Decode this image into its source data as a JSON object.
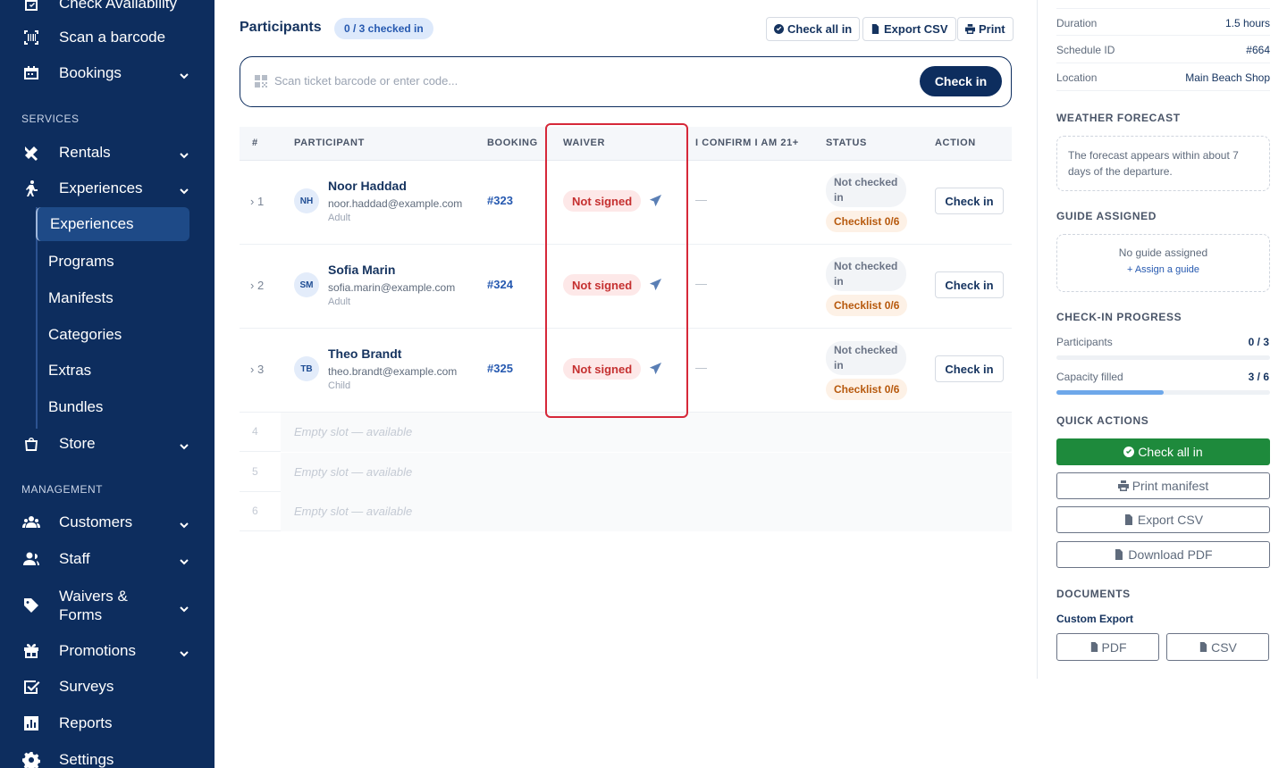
{
  "sidebar": {
    "top_items": [
      {
        "label": "Check Availability",
        "icon": "calendar-check-icon"
      },
      {
        "label": "Scan a barcode",
        "icon": "barcode-scan-icon"
      },
      {
        "label": "Bookings",
        "icon": "bookings-icon"
      }
    ],
    "services_heading": "SERVICES",
    "rentals": "Rentals",
    "experiences": "Experiences",
    "sub_items": [
      "Experiences",
      "Programs",
      "Manifests",
      "Categories",
      "Extras",
      "Bundles"
    ],
    "store": "Store",
    "management_heading": "MANAGEMENT",
    "customers": "Customers",
    "staff": "Staff",
    "waivers": "Waivers & Forms",
    "promotions": "Promotions",
    "surveys": "Surveys",
    "reports": "Reports",
    "settings": "Settings"
  },
  "participants": {
    "title": "Participants",
    "badge": "0 / 3 checked in",
    "check_all": "Check all in",
    "export_csv": "Export CSV",
    "print": "Print",
    "scan_placeholder": "Scan ticket barcode or enter code...",
    "scan_button": "Check in",
    "columns": [
      "#",
      "PARTICIPANT",
      "BOOKING",
      "WAIVER",
      "I CONFIRM I AM 21+",
      "STATUS",
      "ACTION"
    ],
    "rows": [
      {
        "index": "1",
        "initials": "NH",
        "name": "Noor Haddad",
        "email": "noor.haddad@example.com",
        "type": "Adult",
        "booking": "#323",
        "waiver": "Not signed",
        "confirm": "—",
        "status_line1": "Not checked",
        "status_line2": "in",
        "checklist": "Checklist 0/6",
        "action": "Check in"
      },
      {
        "index": "2",
        "initials": "SM",
        "name": "Sofia Marin",
        "email": "sofia.marin@example.com",
        "type": "Adult",
        "booking": "#324",
        "waiver": "Not signed",
        "confirm": "—",
        "status_line1": "Not checked",
        "status_line2": "in",
        "checklist": "Checklist 0/6",
        "action": "Check in"
      },
      {
        "index": "3",
        "initials": "TB",
        "name": "Theo Brandt",
        "email": "theo.brandt@example.com",
        "type": "Child",
        "booking": "#325",
        "waiver": "Not signed",
        "confirm": "—",
        "status_line1": "Not checked",
        "status_line2": "in",
        "checklist": "Checklist 0/6",
        "action": "Check in"
      }
    ],
    "empty_slots": [
      {
        "index": "4",
        "label": "Empty slot — available"
      },
      {
        "index": "5",
        "label": "Empty slot — available"
      },
      {
        "index": "6",
        "label": "Empty slot — available"
      }
    ]
  },
  "details": {
    "duration_label": "Duration",
    "duration_value": "1.5 hours",
    "schedule_label": "Schedule ID",
    "schedule_value": "#664",
    "location_label": "Location",
    "location_value": "Main Beach Shop"
  },
  "weather": {
    "heading": "WEATHER FORECAST",
    "text": "The forecast appears within about 7 days of the departure."
  },
  "guide": {
    "heading": "GUIDE ASSIGNED",
    "text": "No guide assigned",
    "link": "+ Assign a guide"
  },
  "progress": {
    "heading": "CHECK-IN PROGRESS",
    "participants_label": "Participants",
    "participants_value": "0 / 3",
    "participants_fraction": 0,
    "capacity_label": "Capacity filled",
    "capacity_value": "3 / 6",
    "capacity_fraction": 0.5
  },
  "quick_actions": {
    "heading": "QUICK ACTIONS",
    "check_all": "Check all in",
    "print_manifest": "Print manifest",
    "export_csv": "Export CSV",
    "download_pdf": "Download PDF"
  },
  "documents": {
    "heading": "DOCUMENTS",
    "custom_export": "Custom Export",
    "pdf": "PDF",
    "csv": "CSV"
  },
  "colors": {
    "sidebar": "#0d2d5e",
    "primary": "#0d2d5e",
    "success": "#1e8a3c",
    "danger": "#c53030",
    "highlight": "#d62839"
  }
}
